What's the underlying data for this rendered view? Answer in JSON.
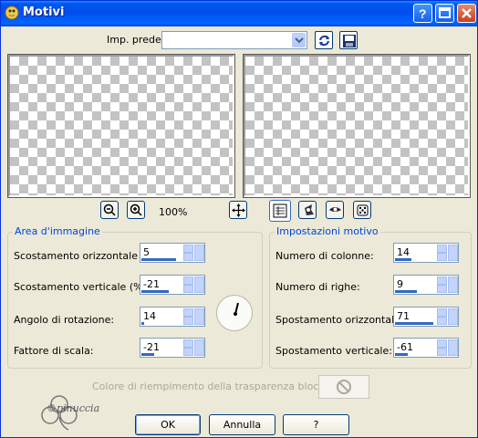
{
  "window": {
    "title": "Motivi",
    "icon": "app-icon",
    "title_buttons": [
      "help-icon",
      "maximize-icon",
      "close-icon"
    ]
  },
  "toolbar": {
    "preset_label": "Imp. predef.:",
    "preset_value": "",
    "swap_icon": "swap-icon",
    "save_icon": "save-icon"
  },
  "zoom": {
    "zoom_out_icon": "zoom-out-icon",
    "zoom_in_icon": "zoom-in-icon",
    "level": "100%",
    "pan_icon": "pan-icon"
  },
  "view_buttons": [
    "proof-icon",
    "drag-hand-icon",
    "eye-icon",
    "dice-icon"
  ],
  "image_area": {
    "title": "Area d'immagine",
    "fields": [
      {
        "label": "Scostamento orizzontale (%):",
        "value": "5"
      },
      {
        "label": "Scostamento verticale (%):",
        "value": "-21"
      },
      {
        "label": "Angolo di rotazione:",
        "value": "14"
      },
      {
        "label": "Fattore di scala:",
        "value": "-21"
      }
    ]
  },
  "pattern_settings": {
    "title": "Impostazioni motivo",
    "fields": [
      {
        "label": "Numero di colonne:",
        "value": "14"
      },
      {
        "label": "Numero di righe:",
        "value": "9"
      },
      {
        "label": "Spostamento orizzontale:",
        "value": "71"
      },
      {
        "label": "Spostamento verticale:",
        "value": "-61"
      }
    ]
  },
  "transparency": {
    "label": "Colore di riempimento della trasparenza bloccato:"
  },
  "buttons": {
    "ok": "OK",
    "cancel": "Annulla",
    "help": "?"
  },
  "logo_text": "©pinuccia",
  "colors": {
    "accent": "#316ac5",
    "titlebar": "#0053ee",
    "group_title": "#0046d5",
    "face": "#ece9d8"
  }
}
